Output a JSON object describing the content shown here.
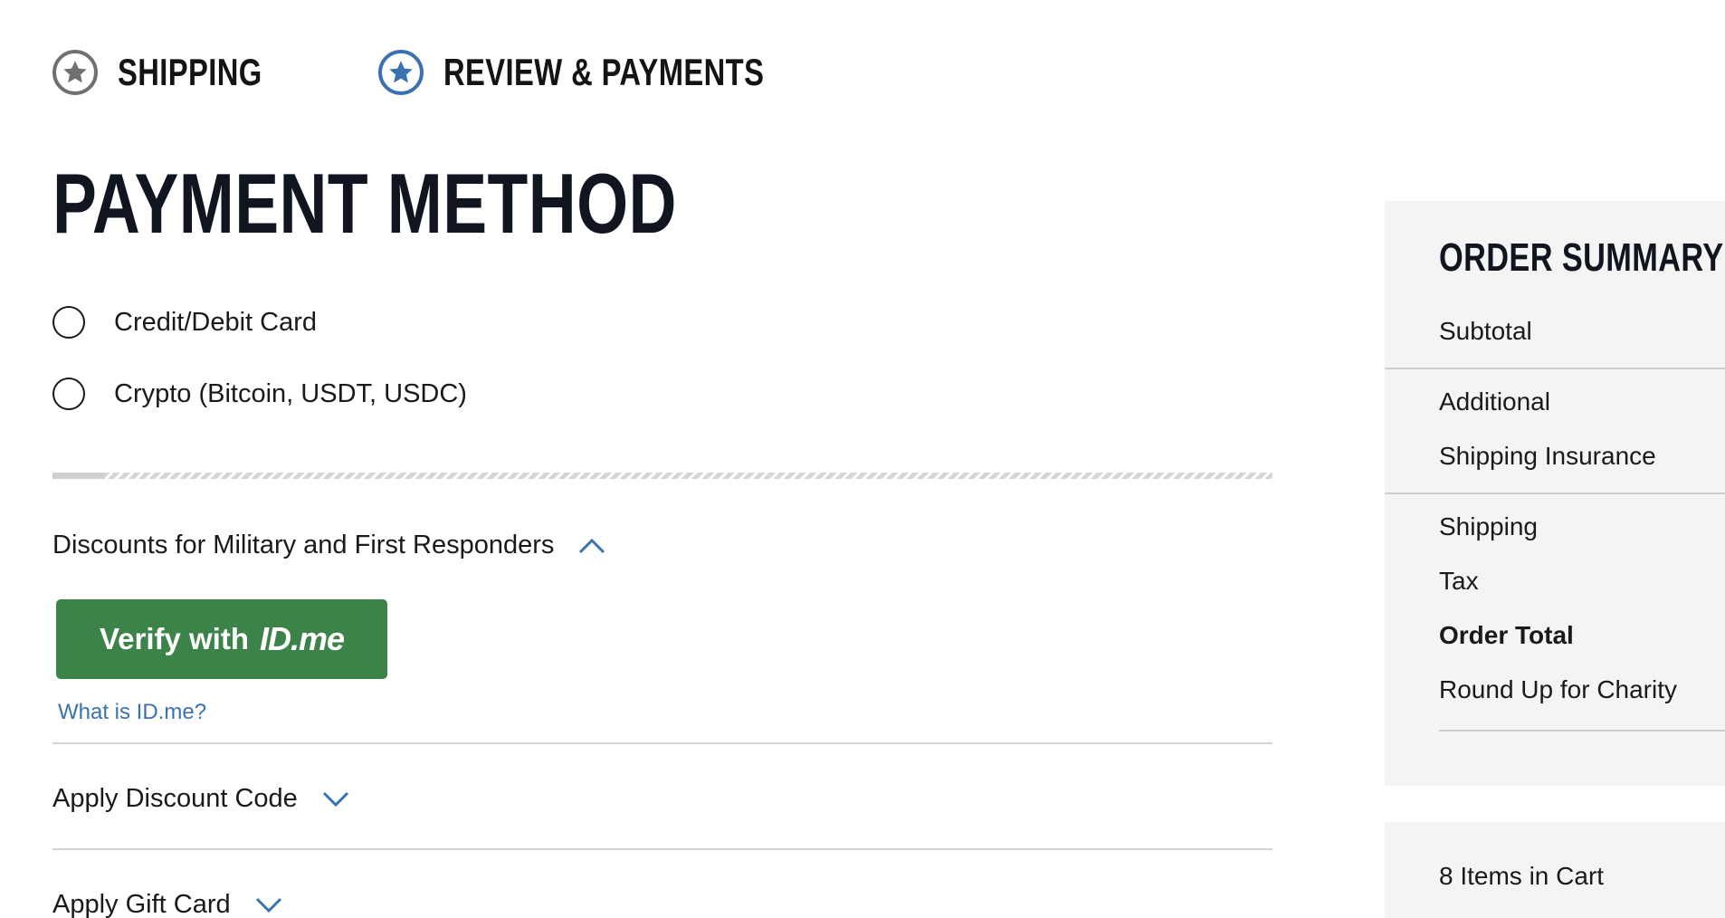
{
  "steps": [
    {
      "label": "SHIPPING",
      "icon": "star-icon",
      "state": "completed"
    },
    {
      "label": "REVIEW & PAYMENTS",
      "icon": "star-icon",
      "state": "active"
    }
  ],
  "payment": {
    "title": "PAYMENT METHOD",
    "options": [
      {
        "label": "Credit/Debit Card",
        "selected": false
      },
      {
        "label": "Crypto (Bitcoin, USDT, USDC)",
        "selected": false
      }
    ]
  },
  "discounts": {
    "military": {
      "label": "Discounts for Military and First Responders",
      "expanded": true,
      "button_verify": "Verify with",
      "button_brand": "ID.me",
      "link": "What is ID.me?"
    },
    "code": {
      "label": "Apply Discount Code",
      "expanded": false
    },
    "gift": {
      "label": "Apply Gift Card",
      "expanded": false
    }
  },
  "summary": {
    "title": "ORDER SUMMARY",
    "rows": {
      "subtotal": "Subtotal",
      "additional": "Additional",
      "insurance": "Shipping Insurance",
      "shipping": "Shipping",
      "tax": "Tax",
      "total": "Order Total",
      "charity": "Round Up for Charity"
    },
    "cart_count": "8 Items in Cart"
  },
  "colors": {
    "accent_blue": "#3a72b0",
    "idme_green": "#3c8349",
    "completed_gray": "#707070",
    "panel_bg": "#f4f4f4"
  }
}
